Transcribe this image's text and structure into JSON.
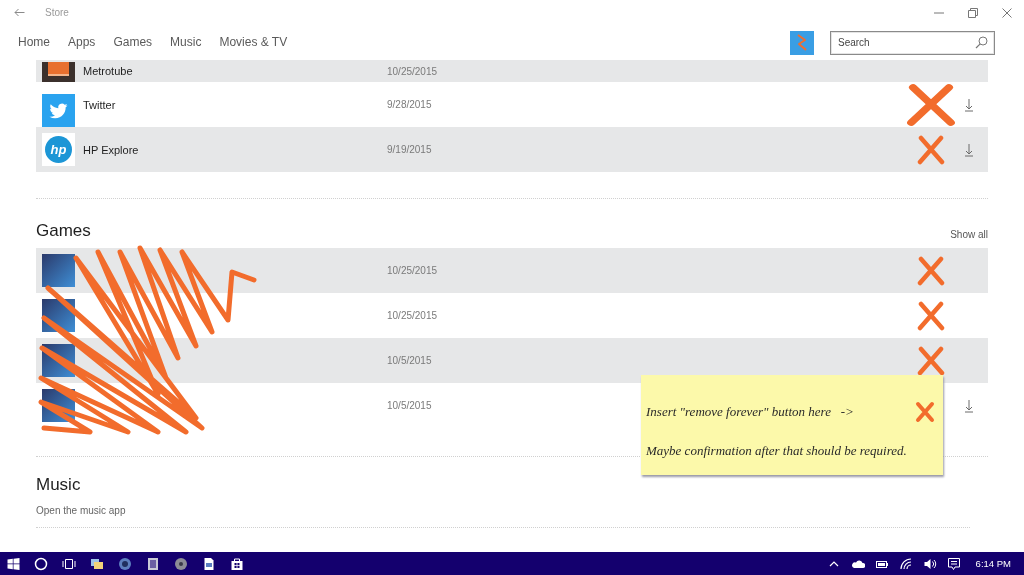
{
  "window": {
    "title": "Store"
  },
  "nav": {
    "tabs": [
      {
        "label": "Home",
        "selected": false
      },
      {
        "label": "Apps",
        "selected": false
      },
      {
        "label": "Games",
        "selected": false
      },
      {
        "label": "Music",
        "selected": false
      },
      {
        "label": "Movies & TV",
        "selected": false
      }
    ]
  },
  "search": {
    "placeholder": "Search"
  },
  "apps": {
    "rows": [
      {
        "kind": "partial",
        "name": "Metrotube",
        "date": "10/25/2015",
        "crossed_out": false,
        "download": false
      },
      {
        "kind": "full",
        "name": "Twitter",
        "date": "9/28/2015",
        "crossed_out": true,
        "download": true
      },
      {
        "kind": "full",
        "logo_text": "hp",
        "name": "HP Explore",
        "date": "9/19/2015",
        "crossed_out": true,
        "download": true
      }
    ]
  },
  "games": {
    "title": "Games",
    "show_all": "Show all",
    "scribbled": true,
    "rows": [
      {
        "kind": "full",
        "date": "10/25/2015",
        "crossed_out": true,
        "download": false
      },
      {
        "kind": "full",
        "date": "10/25/2015",
        "crossed_out": true,
        "download": false
      },
      {
        "kind": "full",
        "date": "10/5/2015",
        "crossed_out": true,
        "download": false
      },
      {
        "kind": "full",
        "date": "10/5/2015",
        "crossed_out": false,
        "download": true
      }
    ]
  },
  "note": {
    "lines": [
      {
        "text": "Insert \"remove forever\" button here   ->",
        "cross": true
      },
      {
        "text": "Maybe confirmation after that should be required.",
        "cross": false
      }
    ]
  },
  "music": {
    "title": "Music",
    "link": "Open the music app"
  },
  "taskbar": {
    "time": "6:14 PM"
  }
}
